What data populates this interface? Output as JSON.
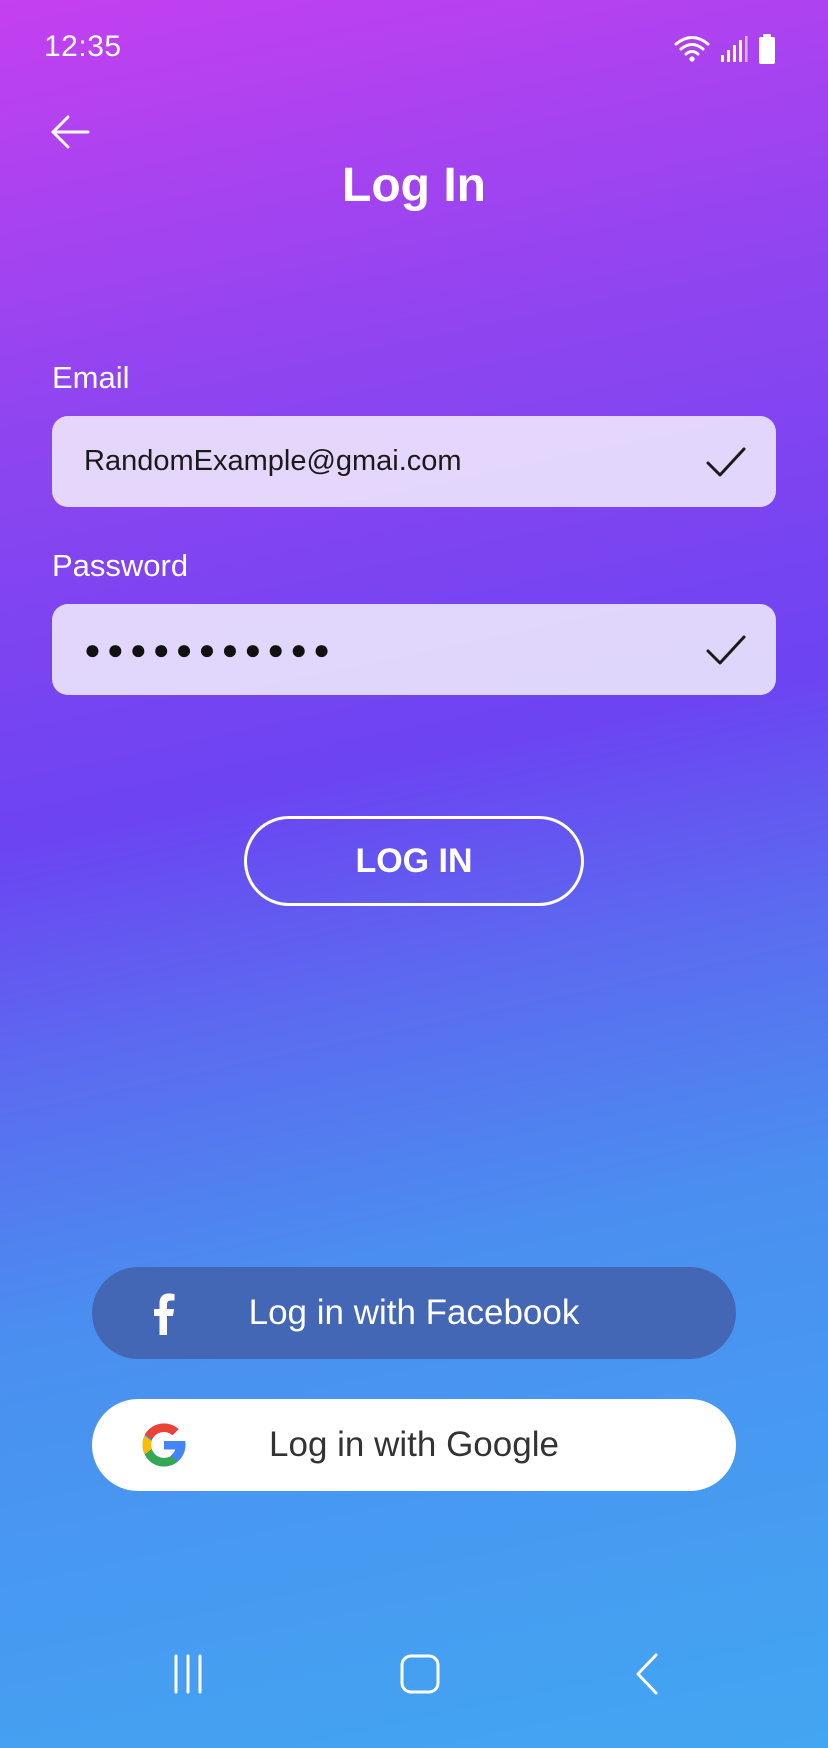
{
  "status_bar": {
    "time": "12:35",
    "icons": [
      "wifi-icon",
      "signal-icon",
      "battery-icon"
    ]
  },
  "header": {
    "back_icon": "arrow-left-icon",
    "title": "Log In"
  },
  "form": {
    "email_label": "Email",
    "email_value": "RandomExample@gmai.com",
    "password_label": "Password",
    "password_value": "●●●●●●●●●●●",
    "valid_icon": "check-icon"
  },
  "login_button": {
    "label": "LOG IN"
  },
  "social": {
    "facebook_label": "Log in with Facebook",
    "facebook_color": "#4467b5",
    "google_label": "Log in with Google"
  },
  "nav_bar": {
    "icons": [
      "recent-apps-icon",
      "home-icon",
      "back-icon"
    ]
  },
  "colors": {
    "gradient_top": "#c440f0",
    "gradient_middle": "#6c44f2",
    "gradient_bottom": "#43a6f2"
  }
}
